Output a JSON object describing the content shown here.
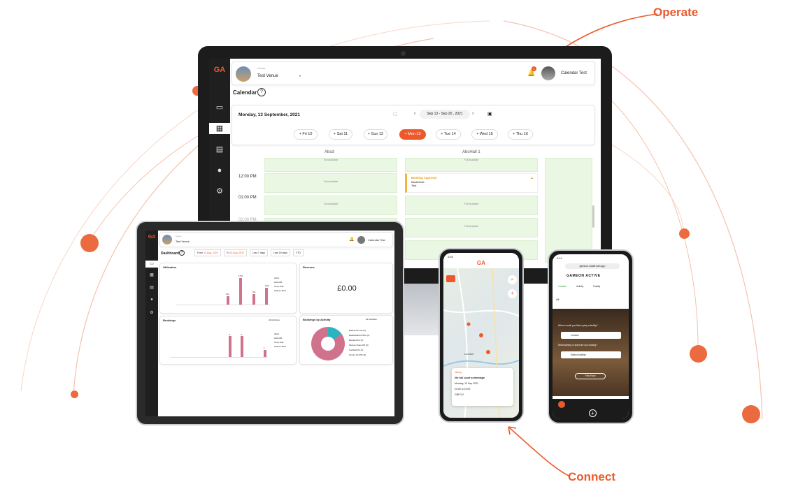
{
  "callouts": {
    "operate": "Operate",
    "connect": "Connect"
  },
  "brand": {
    "logo": "GA",
    "accent": "#ec5a2c",
    "name": "GAMEON ACTIVE"
  },
  "monitor": {
    "venue_label": "Venue",
    "venue_name": "Test Venue",
    "user_name": "Calendar Test",
    "notif_count": "1",
    "page_title": "Calendar",
    "help": "?",
    "date_heading": "Monday, 13 September, 2021",
    "date_range": "Sep 13 - Sep 20 , 2021",
    "days": [
      "+ Fri 10",
      "+ Sat 11",
      "+ Sun 12",
      "+ Mon 13",
      "+ Tue 14",
      "+ Wed 15",
      "+ Thu 16"
    ],
    "columns": [
      "Abcd",
      "AbcHall 1"
    ],
    "times": [
      "12:00 PM",
      "01:00 PM",
      "02:00 PM"
    ],
    "slot_text": "Full Available",
    "booking": {
      "title": "Booking Approval",
      "line1": "Basketball",
      "line2": "Test"
    }
  },
  "tablet": {
    "venue_label": "Venue",
    "venue_name": "Test Venue",
    "user_name": "Calendar Test",
    "page_title": "Dashboard",
    "help": "?",
    "from_label": "From",
    "from_date": "13 Aug, 2021",
    "to_label": "To",
    "to_date": "13 Aug, 2021",
    "filters": [
      "Last 7 days",
      "Last 30 days",
      "YTD"
    ],
    "utilisation_title": "Utilisation",
    "revenue_title": "Revenue",
    "revenue_value": "£0.00",
    "bookings_title": "Bookings",
    "activity_title": "Bookings by Activity",
    "all_activities": "All Activities",
    "all_facilities": "All Facilities",
    "legend": [
      "Abcd",
      "Abcbd11",
      "Temp Hall",
      "Space Hall 3"
    ],
    "util_bar_labels": [
      "4%",
      "17%",
      "6%",
      "6%",
      "11%"
    ],
    "book_bar_labels": [
      "3",
      "3",
      "1",
      "1"
    ],
    "x_ticks": [
      "Sep 6",
      "Sep 7",
      "Sep 8",
      "Sep 9",
      "Sep 10",
      "Sep 11",
      "Sep 12",
      "Sep 13"
    ],
    "y_ticks": [
      "20%",
      "15%",
      "10%",
      "5%",
      "0%"
    ],
    "pie_labels": [
      "15%",
      "85%"
    ],
    "activity_legend": [
      "Badminton 0% (0)",
      "Basketball 82.35% (0)",
      "Blocked 0% (0)",
      "Fitness Class 0% (0)",
      "Football 0% (0)",
      "Tennis 14.67% (0)"
    ]
  },
  "phone1": {
    "time": "4:53",
    "logo": "GA",
    "map_label": "London",
    "venue_chip": "Jimmy",
    "title": "2hr full court scrimmage",
    "date": "Monday, 13 Sep 2021",
    "time_range": "20:00 to 22:00",
    "price": "GBP 0.0"
  },
  "phone2": {
    "time": "4:14",
    "url": "gameon-2da8f.web.app",
    "brand": "GAMEON ACTIVE",
    "tabs": [
      "Location",
      "Activity",
      "Facility"
    ],
    "filter": "All",
    "q1": "Where would you like to play a facility?",
    "loc": "London",
    "q2": "What activity or sport are you looking?",
    "act": "Select Activity",
    "btn": "Find Now"
  }
}
